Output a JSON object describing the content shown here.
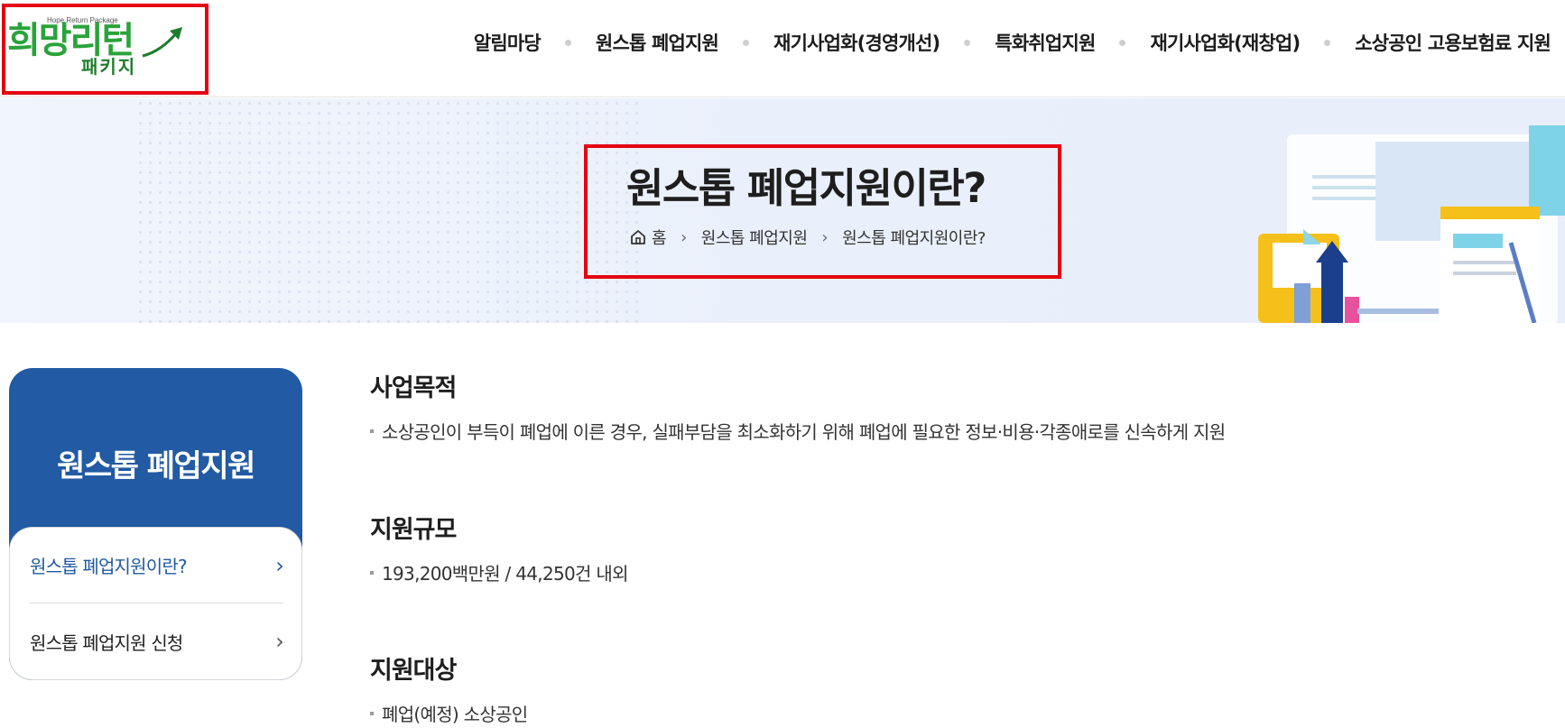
{
  "header": {
    "logo": {
      "en": "Hope Return Package",
      "main": "희망리턴",
      "sub": "패키지"
    },
    "nav": [
      "알림마당",
      "원스톱 폐업지원",
      "재기사업화(경영개선)",
      "특화취업지원",
      "재기사업화(재창업)",
      "소상공인 고용보험료 지원"
    ]
  },
  "banner": {
    "title": "원스톱 폐업지원이란?",
    "breadcrumb": {
      "home": "홈",
      "level1": "원스톱 폐업지원",
      "level2": "원스톱 폐업지원이란?"
    }
  },
  "sidebar": {
    "title": "원스톱 폐업지원",
    "items": [
      {
        "label": "원스톱 폐업지원이란?",
        "active": true
      },
      {
        "label": "원스톱 폐업지원 신청",
        "active": false
      }
    ],
    "arrow": "›"
  },
  "content": {
    "sections": [
      {
        "heading": "사업목적",
        "text": "소상공인이 부득이 폐업에 이른 경우, 실패부담을 최소화하기 위해 폐업에 필요한 정보·비용·각종애로를 신속하게 지원"
      },
      {
        "heading": "지원규모",
        "text": "193,200백만원 / 44,250건 내외"
      },
      {
        "heading": "지원대상",
        "text": "폐업(예정) 소상공인"
      }
    ]
  },
  "colors": {
    "primary": "#225aa3",
    "highlight": "#e60012",
    "logo_green": "#2aa33a"
  }
}
